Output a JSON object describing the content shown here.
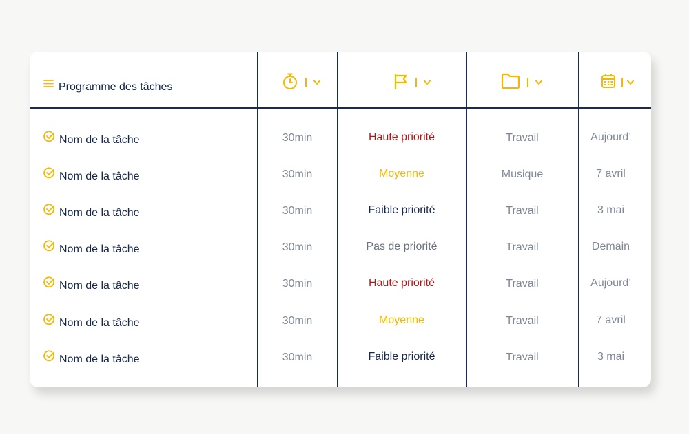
{
  "header": {
    "title": "Programme des tâches",
    "menu_icon": "menu-icon",
    "columns": [
      {
        "icon": "stopwatch-icon"
      },
      {
        "icon": "flag-icon"
      },
      {
        "icon": "folder-icon"
      },
      {
        "icon": "calendar-icon"
      }
    ]
  },
  "colors": {
    "accent": "#f5b800",
    "text_dark": "#15264a",
    "text_muted": "#7f8797",
    "priority_high": "#b01717",
    "priority_medium": "#f5b800",
    "priority_low": "#15264a",
    "priority_none": "#6b7280"
  },
  "rows": [
    {
      "task": "Nom de la tâche",
      "duration": "30min",
      "priority": "Haute priorité",
      "priority_level": "high",
      "category": "Travail",
      "date": "Aujourd’"
    },
    {
      "task": "Nom de la tâche",
      "duration": "30min",
      "priority": "Moyenne",
      "priority_level": "medium",
      "category": "Musique",
      "date": "7 avril"
    },
    {
      "task": "Nom de la tâche",
      "duration": "30min",
      "priority": "Faible priorité",
      "priority_level": "low",
      "category": "Travail",
      "date": "3 mai"
    },
    {
      "task": "Nom de la tâche",
      "duration": "30min",
      "priority": "Pas de priorité",
      "priority_level": "none",
      "category": "Travail",
      "date": "Demain"
    },
    {
      "task": "Nom de la tâche",
      "duration": "30min",
      "priority": "Haute priorité",
      "priority_level": "high",
      "category": "Travail",
      "date": "Aujourd’"
    },
    {
      "task": "Nom de la tâche",
      "duration": "30min",
      "priority": "Moyenne",
      "priority_level": "medium",
      "category": "Travail",
      "date": "7 avril"
    },
    {
      "task": "Nom de la tâche",
      "duration": "30min",
      "priority": "Faible priorité",
      "priority_level": "low",
      "category": "Travail",
      "date": "3 mai"
    }
  ]
}
